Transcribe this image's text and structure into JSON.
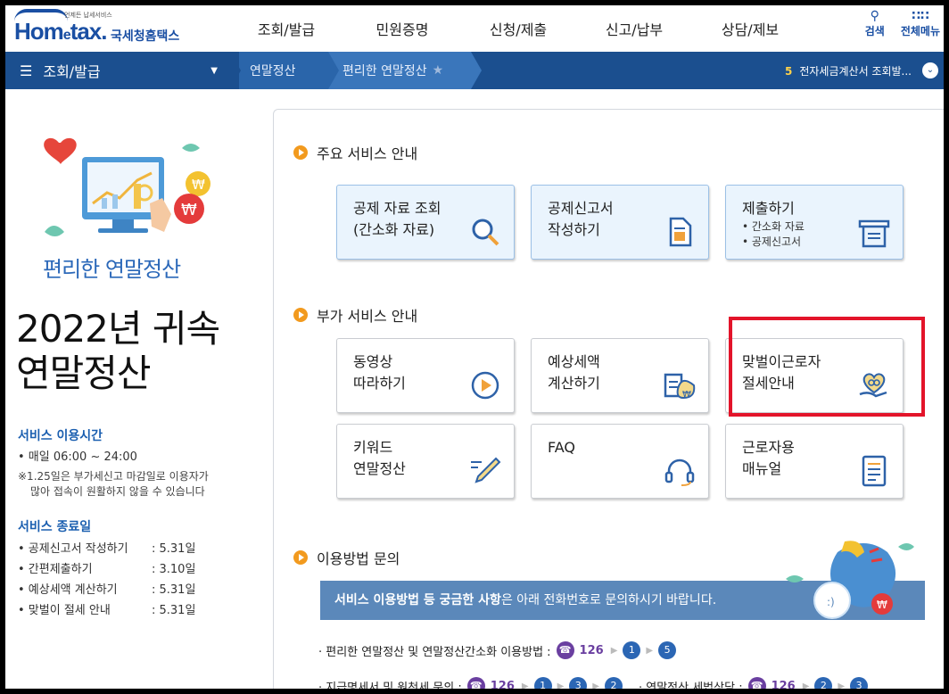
{
  "header": {
    "logo_small": "언제든 납세서비스",
    "logo_brand_1": "Hom",
    "logo_brand_e": "e",
    "logo_brand_2": "tax.",
    "logo_kr": "국세청홈택스",
    "gnb": [
      "조회/발급",
      "민원증명",
      "신청/제출",
      "신고/납부",
      "상담/제보"
    ],
    "tools": [
      {
        "label": "검색",
        "icon": "search-icon"
      },
      {
        "label": "전체메뉴",
        "icon": "grid-menu-icon"
      }
    ]
  },
  "navbar": {
    "main": "조회/발급",
    "crumbs": [
      "연말정산",
      "편리한 연말정산"
    ],
    "notice_num": "5",
    "notice_text": "전자세금계산서 조회발..."
  },
  "left": {
    "subtitle": "편리한 연말정산",
    "title_line1": "2022년 귀속",
    "title_line2": "연말정산",
    "hours_head": "서비스 이용시간",
    "hours_text": "• 매일 06:00 ~ 24:00",
    "hours_note_1": "※1.25일은 부가세신고 마감일로 이용자가",
    "hours_note_2": "많아 접속이 원활하지 않을 수 있습니다",
    "end_head": "서비스 종료일",
    "end_list": [
      {
        "label": "• 공제신고서 작성하기",
        "date": ": 5.31일"
      },
      {
        "label": "• 간편제출하기",
        "date": ": 3.10일"
      },
      {
        "label": "• 예상세액 계산하기",
        "date": ": 5.31일"
      },
      {
        "label": "• 맞벌이 절세 안내",
        "date": ": 5.31일"
      }
    ]
  },
  "main": {
    "section1": "주요 서비스 안내",
    "section2": "부가 서비스 안내",
    "section3": "이용방법 문의",
    "cards_main": [
      {
        "label": "공제 자료 조회\n(간소화 자료)",
        "icon": "magnifier-icon"
      },
      {
        "label": "공제신고서\n작성하기",
        "icon": "document-icon"
      },
      {
        "label": "제출하기",
        "sub1": "• 간소화 자료",
        "sub2": "• 공제신고서",
        "icon": "submit-tray-icon"
      }
    ],
    "cards_extra": [
      {
        "label": "동영상\n따라하기",
        "icon": "play-icon"
      },
      {
        "label": "예상세액\n계산하기",
        "icon": "calculator-won-icon"
      },
      {
        "label": "맞벌이근로자\n절세안내",
        "icon": "heart-hand-icon"
      },
      {
        "label": "키워드\n연말정산",
        "icon": "pen-icon"
      },
      {
        "label": "FAQ",
        "icon": "headset-icon"
      },
      {
        "label": "근로자용\n매뉴얼",
        "icon": "manual-icon"
      }
    ],
    "banner_bold": "서비스 이용방법 등 궁금한 사항",
    "banner_rest": "은 아래 전화번호로 문의하시기 바랍니다.",
    "phone1_label": "· 편리한 연말정산 및 연말정산간소화 이용방법 :",
    "phone1_num": "126",
    "phone1_steps": [
      "1",
      "5"
    ],
    "phone2_label": "· 지급명세서 및 원천세 문의 :",
    "phone2_num": "126",
    "phone2_steps": [
      "1",
      "3",
      "2"
    ],
    "phone3_label": "· 연말정산 세법상담 :",
    "phone3_num": "126",
    "phone3_steps": [
      "2",
      "3"
    ]
  },
  "colors": {
    "brand": "#1a4fa3",
    "navbar": "#1b4f8f",
    "accent_orange": "#f29a1e",
    "highlight_red": "#e3142a",
    "phone_purple": "#6a3fa0"
  }
}
